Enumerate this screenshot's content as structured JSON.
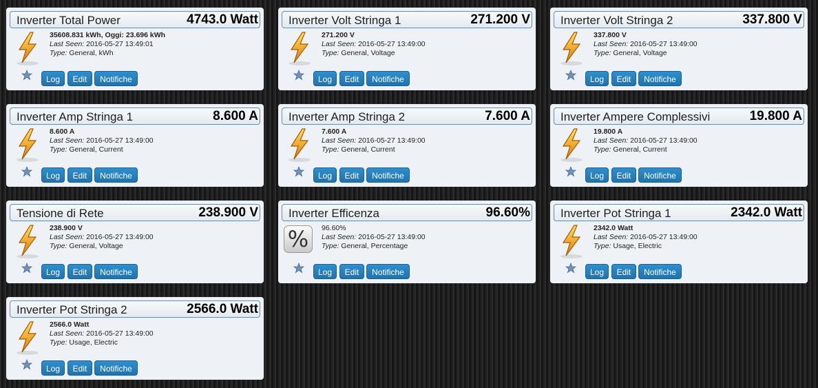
{
  "buttons": {
    "log": "Log",
    "edit": "Edit",
    "notifiche": "Notifiche"
  },
  "labels": {
    "last_seen": "Last Seen:",
    "type": "Type:"
  },
  "devices": [
    {
      "name": "Inverter Total Power",
      "value": "4743.0 Watt",
      "data": "35608.831 kWh, Oggi: 23.696 kWh",
      "last_seen": "2016-05-27 13:49:01",
      "type": "General, kWh",
      "icon": "lightning-icon"
    },
    {
      "name": "Inverter Volt Stringa 1",
      "value": "271.200 V",
      "data": "271.200 V",
      "last_seen": "2016-05-27 13:49:00",
      "type": "General, Voltage",
      "icon": "lightning-icon"
    },
    {
      "name": "Inverter Volt Stringa 2",
      "value": "337.800 V",
      "data": "337.800 V",
      "last_seen": "2016-05-27 13:49:00",
      "type": "General, Voltage",
      "icon": "lightning-icon"
    },
    {
      "name": "Inverter Amp Stringa 1",
      "value": "8.600 A",
      "data": "8.600 A",
      "last_seen": "2016-05-27 13:49:00",
      "type": "General, Current",
      "icon": "lightning-icon"
    },
    {
      "name": "Inverter Amp Stringa 2",
      "value": "7.600 A",
      "data": "7.600 A",
      "last_seen": "2016-05-27 13:49:00",
      "type": "General, Current",
      "icon": "lightning-icon"
    },
    {
      "name": "Inverter Ampere Complessivi",
      "value": "19.800 A",
      "data": "19.800 A",
      "last_seen": "2016-05-27 13:49:00",
      "type": "General, Current",
      "icon": "lightning-icon"
    },
    {
      "name": "Tensione di Rete",
      "value": "238.900 V",
      "data": "238.900 V",
      "last_seen": "2016-05-27 13:49:00",
      "type": "General, Voltage",
      "icon": "lightning-icon"
    },
    {
      "name": "Inverter Efficenza",
      "value": "96.60%",
      "data": "96.60%",
      "last_seen": "2016-05-27 13:49:00",
      "type": "General, Percentage",
      "icon": "percent-icon",
      "icon_glyph": "%"
    },
    {
      "name": "Inverter Pot Stringa 1",
      "value": "2342.0 Watt",
      "data": "2342.0 Watt",
      "last_seen": "2016-05-27 13:49:00",
      "type": "Usage, Electric",
      "icon": "lightning-icon"
    },
    {
      "name": "Inverter Pot Stringa 2",
      "value": "2566.0 Watt",
      "data": "2566.0 Watt",
      "last_seen": "2016-05-27 13:49:00",
      "type": "Usage, Electric",
      "icon": "lightning-icon"
    }
  ]
}
